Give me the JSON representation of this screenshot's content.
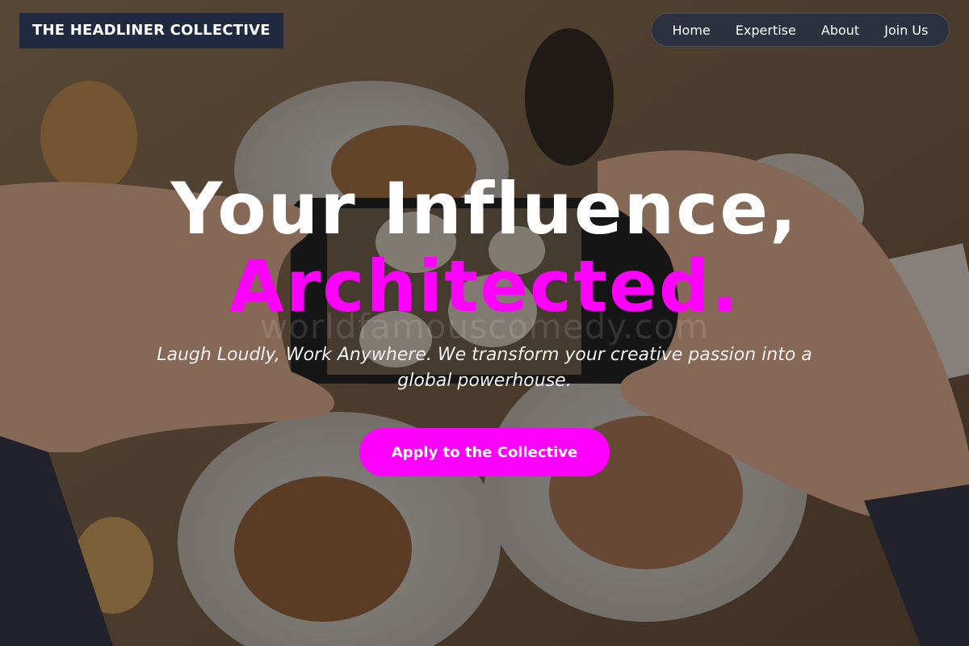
{
  "header": {
    "logo_text": "THE HEADLINER COLLECTIVE"
  },
  "nav": {
    "items": [
      {
        "label": "Home"
      },
      {
        "label": "Expertise"
      },
      {
        "label": "About"
      },
      {
        "label": "Join Us"
      }
    ]
  },
  "hero": {
    "headline_line1": "Your Influence,",
    "headline_line2": "Architected.",
    "watermark": "worldfamouscomedy.com",
    "subtitle": "Laugh Loudly, Work Anywhere. We transform your creative passion into a global powerhouse.",
    "cta_label": "Apply to the Collective"
  },
  "colors": {
    "accent": "#ff00ff",
    "logo_bg": "#1f2a40",
    "nav_bg": "#283042"
  }
}
